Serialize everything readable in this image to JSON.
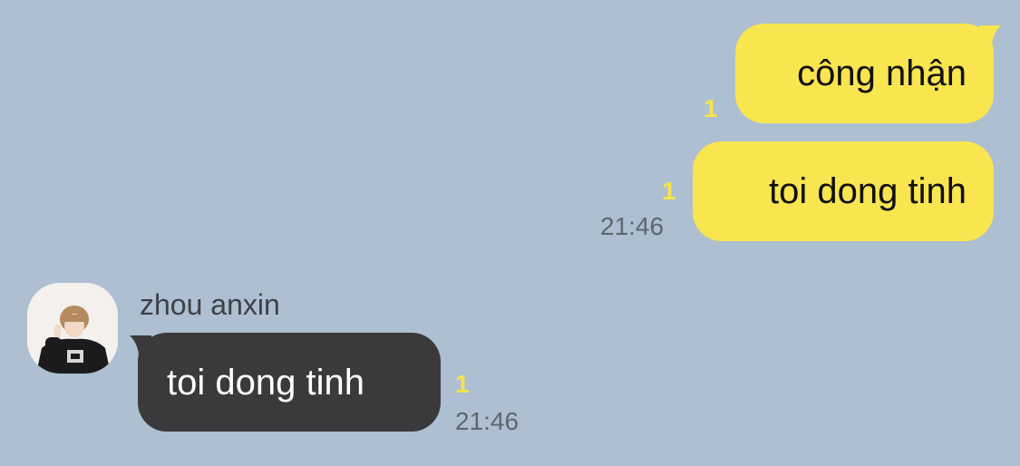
{
  "chat": {
    "messages": [
      {
        "direction": "outgoing",
        "text": "công nhận",
        "unread": "1",
        "time": ""
      },
      {
        "direction": "outgoing",
        "text": "toi dong tinh",
        "unread": "1",
        "time": "21:46"
      },
      {
        "direction": "incoming",
        "sender": "zhou anxin",
        "text": "toi dong tinh",
        "unread": "1",
        "time": "21:46"
      }
    ]
  },
  "colors": {
    "background": "#adbfd0",
    "outgoing_bubble": "#f9e54f",
    "incoming_bubble": "#3a3a3c",
    "unread_count": "#f7e34a",
    "timestamp": "#5d6770"
  },
  "icons": {
    "avatar": "profile-photo"
  }
}
